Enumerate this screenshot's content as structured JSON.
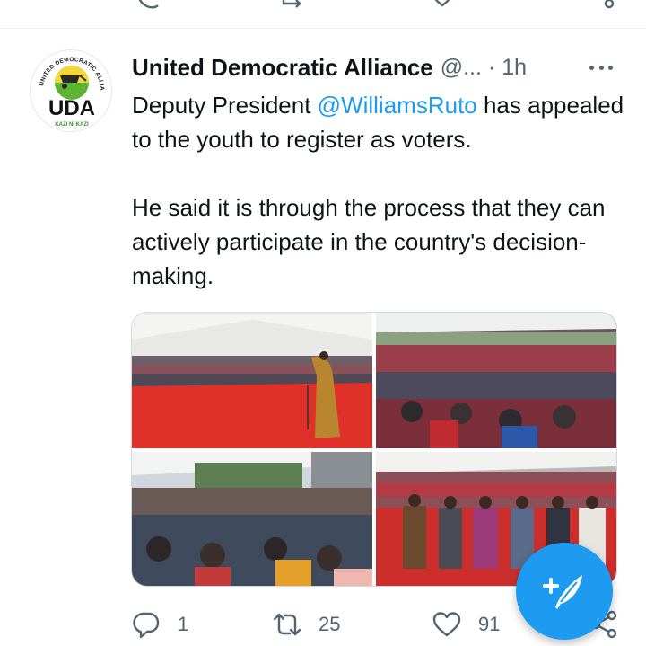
{
  "tweet": {
    "author": {
      "display_name": "United Democratic Alliance",
      "handle": "@...",
      "avatar_text": "UDA",
      "avatar_ring_text": "UNITED DEMOCRATIC ALLIANCE",
      "avatar_motto": "KAZI NI KAZI"
    },
    "separator": "·",
    "time": "1h",
    "text": {
      "line1_before": "Deputy President ",
      "mention": "@WilliamsRuto",
      "line1_after": " has appealed to the youth to register as voters.",
      "paragraph2": "He said it is through the process that they can actively participate in the country's decision-making."
    },
    "media": [
      {
        "name": "photo-1"
      },
      {
        "name": "photo-2"
      },
      {
        "name": "photo-3"
      },
      {
        "name": "photo-4"
      }
    ],
    "actions": {
      "reply_count": "1",
      "retweet_count": "25",
      "like_count": "91"
    }
  },
  "colors": {
    "accent": "#1d9bf0",
    "secondary_text": "#536471",
    "primary_text": "#0f1419"
  },
  "icons": {
    "reply": "reply-icon",
    "retweet": "retweet-icon",
    "like": "heart-icon",
    "share": "share-icon",
    "more": "more-icon",
    "compose": "compose-icon"
  }
}
